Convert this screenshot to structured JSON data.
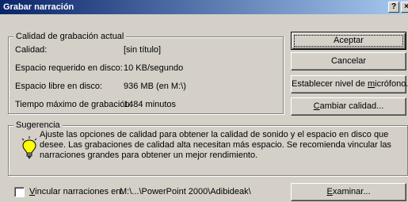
{
  "window": {
    "title": "Grabar narración",
    "help_label": "?",
    "close_label": "×"
  },
  "quality_group": {
    "legend": "Calidad de grabación actual",
    "rows": [
      {
        "label": "Calidad:",
        "value": "[sin título]"
      },
      {
        "label": "Espacio requerido en disco:",
        "value": "10 KB/segundo"
      },
      {
        "label": "Espacio libre en disco:",
        "value": "936 MB (en M:\\)"
      },
      {
        "label": "Tiempo máximo de grabación:",
        "value": "1484 minutos"
      }
    ]
  },
  "buttons": {
    "ok": "Aceptar",
    "cancel": "Cancelar",
    "mic_pre": "Establecer nivel de ",
    "mic_ul": "m",
    "mic_post": "icrófono...",
    "quality_ul": "C",
    "quality_post": "ambiar calidad...",
    "browse_ul": "E",
    "browse_post": "xaminar..."
  },
  "tip": {
    "legend": "Sugerencia",
    "text": "Ajuste las opciones de calidad para obtener la calidad de sonido y el espacio en disco que desee. Las grabaciones de calidad alta necesitan más espacio. Se recomienda vincular las narraciones grandes para obtener un mejor rendimiento.",
    "icon": "lightbulb-icon"
  },
  "link": {
    "label_ul": "V",
    "label_post": "incular narraciones en:",
    "checked": false,
    "path": "M:\\...\\PowerPoint 2000\\Adibideak\\"
  }
}
